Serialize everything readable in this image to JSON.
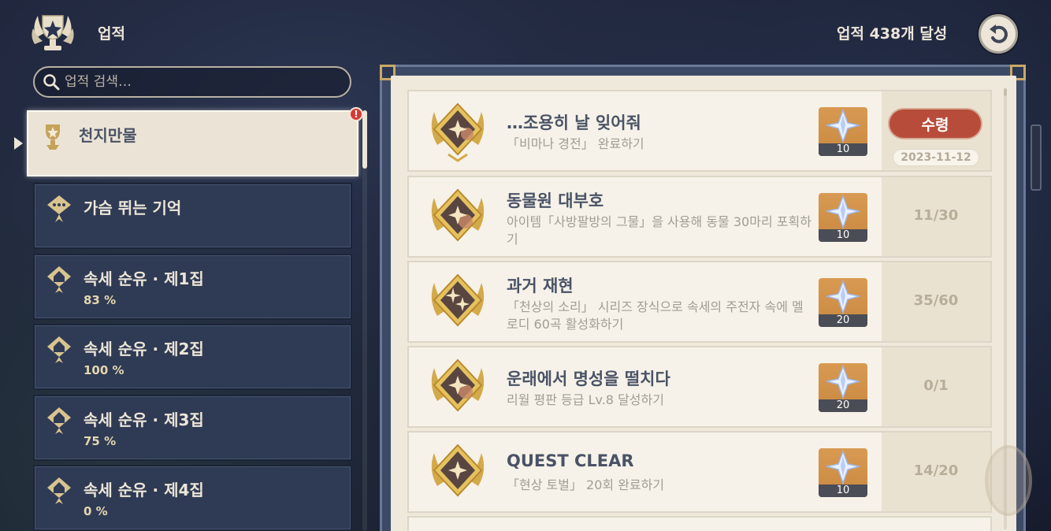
{
  "header": {
    "title": "업적",
    "total": "업적 438개 달성"
  },
  "search": {
    "placeholder": "업적 검색…"
  },
  "categories": [
    {
      "name": "천지만물",
      "pct": "",
      "active": true,
      "alert": "!"
    },
    {
      "name": "가슴 뛰는 기억",
      "pct": ""
    },
    {
      "name": "속세 순유 · 제1집",
      "pct": "83 %"
    },
    {
      "name": "속세 순유 · 제2집",
      "pct": "100 %"
    },
    {
      "name": "속세 순유 · 제3집",
      "pct": "75 %"
    },
    {
      "name": "속세 순유 · 제4집",
      "pct": "0 %"
    }
  ],
  "achievements": [
    {
      "title": "…조용히 날 잊어줘",
      "desc": "「비마나 경전」 완료하기",
      "reward": "10",
      "status": "claim",
      "claim_label": "수령",
      "date": "2023-11-12"
    },
    {
      "title": "동물원 대부호",
      "desc": "아이템「사방팔방의 그물」을 사용해 동물 30마리 포획하기",
      "reward": "10",
      "progress": "11/30"
    },
    {
      "title": "과거 재현",
      "desc": "「천상의 소리」 시리즈 장식으로 속세의 주전자 속에 멜로디 60곡 활성화하기",
      "reward": "20",
      "progress": "35/60"
    },
    {
      "title": "운래에서 명성을 떨치다",
      "desc": "리월 평판 등급 Lv.8 달성하기",
      "reward": "20",
      "progress": "0/1"
    },
    {
      "title": "QUEST CLEAR",
      "desc": "「현상 토벌」 20회 완료하기",
      "reward": "10",
      "progress": "14/20"
    }
  ],
  "icons": {
    "header": "trophy-emblem-icon",
    "back": "back-arrow-icon",
    "search": "search-icon",
    "reward": "primogem-icon",
    "medal": "achievement-medal-icon"
  },
  "colors": {
    "accent_gold": "#d4a94a",
    "claim_red": "#b84c3b",
    "page_bg": "#efe9dc",
    "panel_blue": "#2f3b54"
  }
}
